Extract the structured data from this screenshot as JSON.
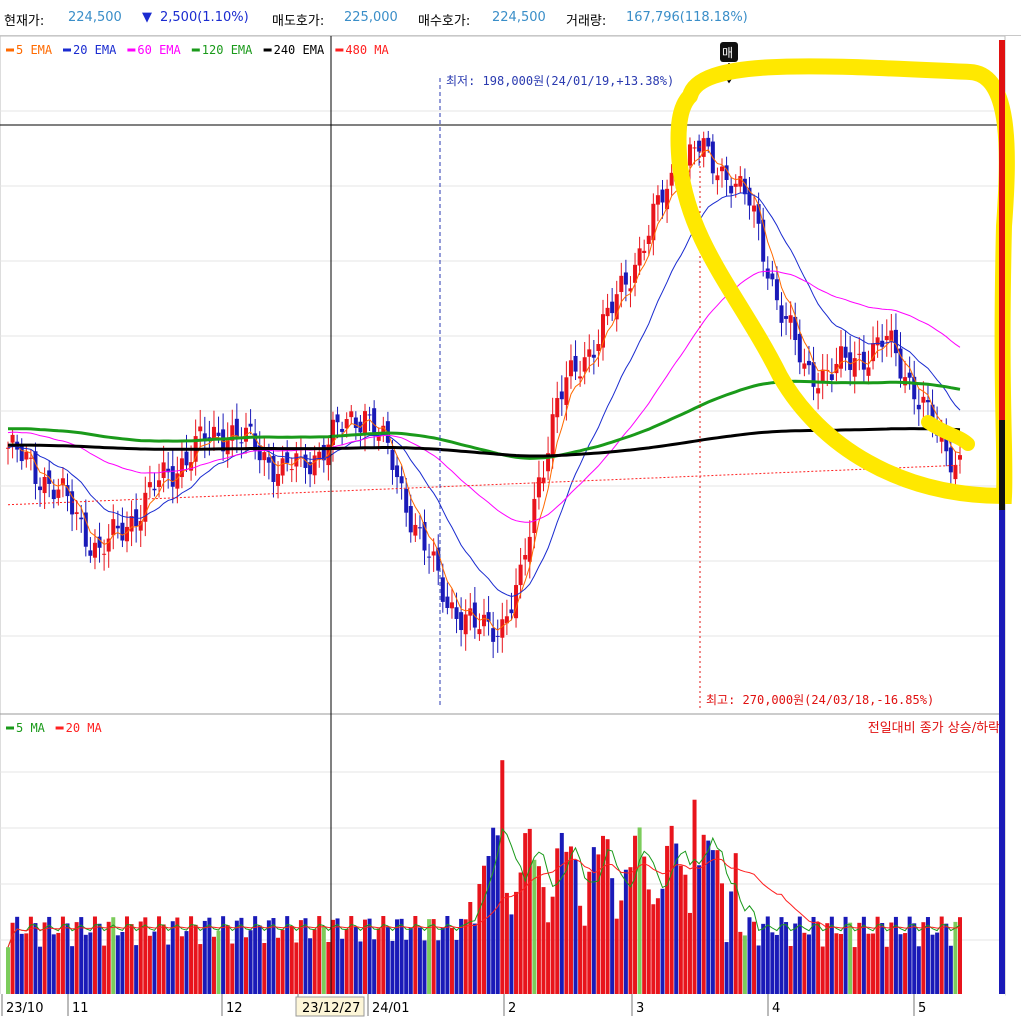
{
  "header": {
    "price_label": "현재가:",
    "price_value": "224,500",
    "change_arrow": "▼",
    "change_value": "2,500(1.10%)",
    "ask_label": "매도호가:",
    "ask_value": "225,000",
    "bid_label": "매수호가:",
    "bid_value": "224,500",
    "volume_label": "거래량:",
    "volume_value": "167,796(118.18%)"
  },
  "price_legend": [
    {
      "label": "5 EMA",
      "color": "#ff6a00"
    },
    {
      "label": "20 EMA",
      "color": "#1a2bd0"
    },
    {
      "label": "60 EMA",
      "color": "#ff00ff"
    },
    {
      "label": "120 EMA",
      "color": "#1a9a1a"
    },
    {
      "label": "240 EMA",
      "color": "#000000"
    },
    {
      "label": "480 MA",
      "color": "#ff2020"
    }
  ],
  "volume_legend": [
    {
      "label": "5 MA",
      "color": "#1a9a1a"
    },
    {
      "label": "20 MA",
      "color": "#ff2020"
    }
  ],
  "volume_note": "전일대비 종가 상승/하락",
  "annotations": {
    "low": "최저: 198,000원(24/01/19,+13.38%)",
    "high": "최고: 270,000원(24/03/18,-16.85%)",
    "sell_badge": "매"
  },
  "colors": {
    "up": "#e8141c",
    "down": "#1a1ab8",
    "flat_volume": "#7ccc5c",
    "highlight": "#ffe800",
    "label_blue": "#2a3ab0",
    "label_red": "#e01010"
  },
  "chart_data": [
    {
      "type": "candlestick",
      "title": "",
      "x_ticks": [
        "23/10",
        "11",
        "12",
        "23/12/27",
        "24/01",
        "2",
        "3",
        "4",
        "5"
      ],
      "ylim": [
        192000,
        276000
      ],
      "series": [
        {
          "name": "5 EMA",
          "values_note": "short-term average following closes"
        },
        {
          "name": "20 EMA"
        },
        {
          "name": "60 EMA"
        },
        {
          "name": "120 EMA"
        },
        {
          "name": "240 EMA"
        },
        {
          "name": "480 MA"
        }
      ],
      "events": [
        {
          "label": "low",
          "date": "24/01/19",
          "value": 198000
        },
        {
          "label": "high",
          "date": "24/03/18",
          "value": 270000
        }
      ]
    },
    {
      "type": "bar",
      "title": "",
      "series": [
        {
          "name": "5 MA"
        },
        {
          "name": "20 MA"
        }
      ]
    }
  ]
}
